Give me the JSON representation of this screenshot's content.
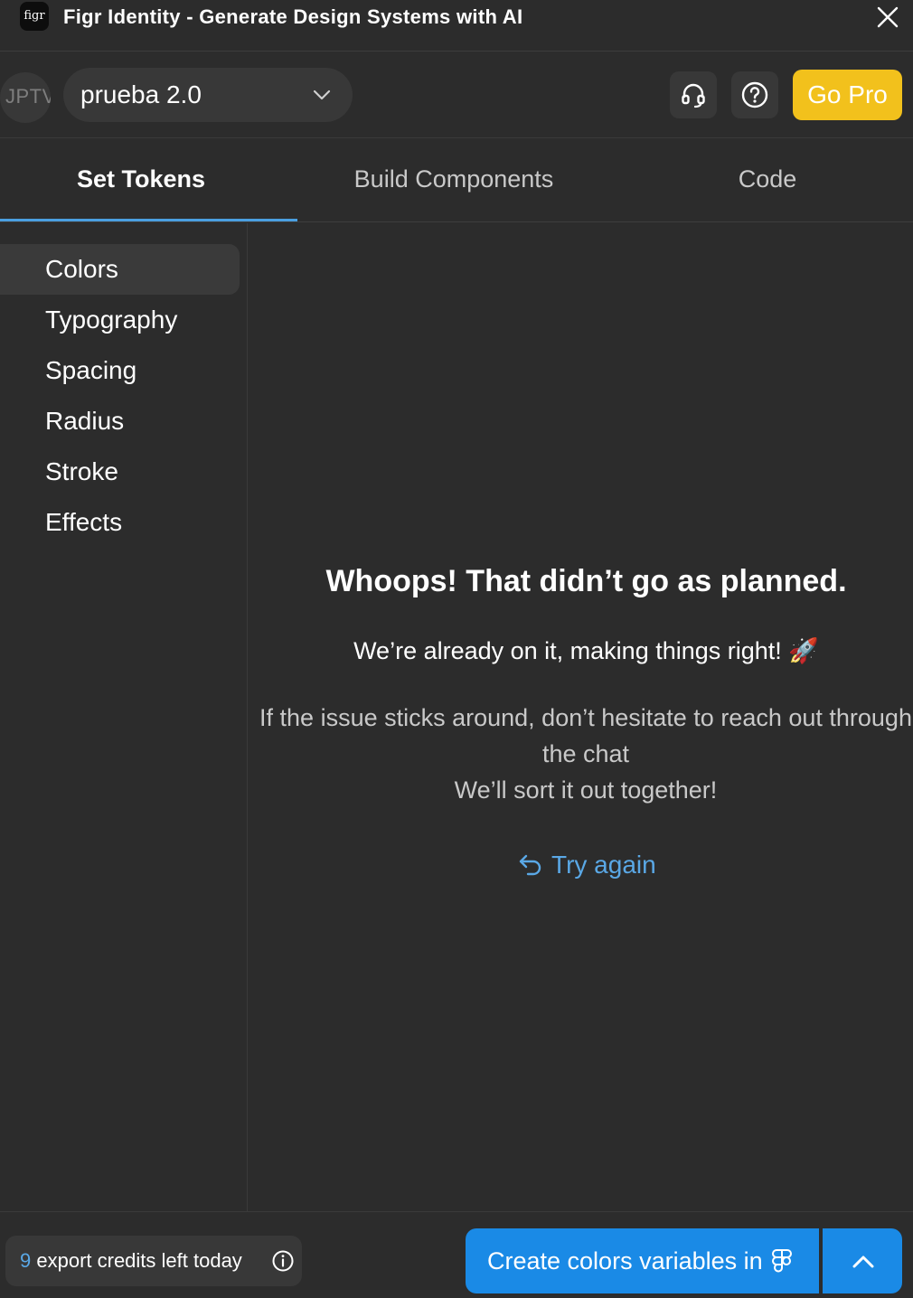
{
  "window": {
    "logo_text": "figr",
    "title": "Figr Identity - Generate Design Systems with AI"
  },
  "header": {
    "avatar_initials": "JPTV",
    "project_name": "prueba 2.0",
    "go_pro_label": "Go Pro"
  },
  "tabs": [
    {
      "label": "Set Tokens",
      "active": true
    },
    {
      "label": "Build Components",
      "active": false
    },
    {
      "label": "Code",
      "active": false
    }
  ],
  "sidebar": {
    "items": [
      {
        "label": "Colors",
        "active": true
      },
      {
        "label": "Typography",
        "active": false
      },
      {
        "label": "Spacing",
        "active": false
      },
      {
        "label": "Radius",
        "active": false
      },
      {
        "label": "Stroke",
        "active": false
      },
      {
        "label": "Effects",
        "active": false
      }
    ]
  },
  "error": {
    "title": "Whoops! That didn’t go as planned.",
    "subtitle": "We’re already on it, making things right! 🚀",
    "help_line1": "If the issue sticks around, don’t hesitate to reach out through",
    "help_line2": "the chat",
    "help_line3": "We’ll sort it out together!",
    "retry_label": "Try again"
  },
  "footer": {
    "credits_count": "9",
    "credits_label": " export credits left today",
    "create_button_label": "Create colors variables in"
  },
  "colors": {
    "background": "#2c2c2c",
    "surface": "#383838",
    "accent_blue": "#1a8ae6",
    "link_blue": "#5aa8e6",
    "go_pro_yellow": "#f2c11c"
  },
  "icons": {
    "close": "close-icon",
    "chevron": "chevron-down-icon",
    "support": "headset-icon",
    "help": "question-circle-icon",
    "retry": "undo-arrow-icon",
    "info": "info-circle-icon",
    "figma": "figma-icon",
    "expand": "chevron-up-icon"
  }
}
